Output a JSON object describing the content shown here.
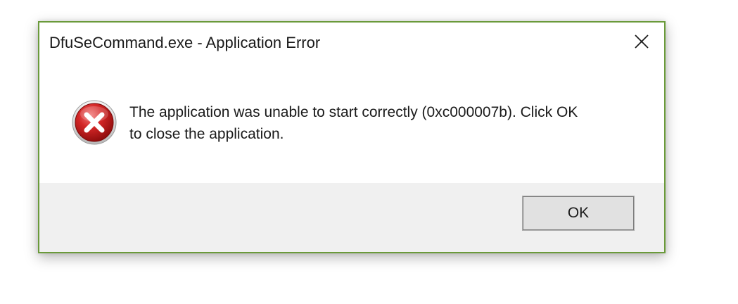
{
  "window": {
    "title": "DfuSeCommand.exe - Application Error",
    "close_icon": "close-icon",
    "border_color": "#6a9a3a"
  },
  "body": {
    "icon": "error-icon",
    "message_line1": "The application was unable to start correctly (0xc000007b). Click OK",
    "message_line2": "to close the application."
  },
  "footer": {
    "ok_label": "OK"
  }
}
